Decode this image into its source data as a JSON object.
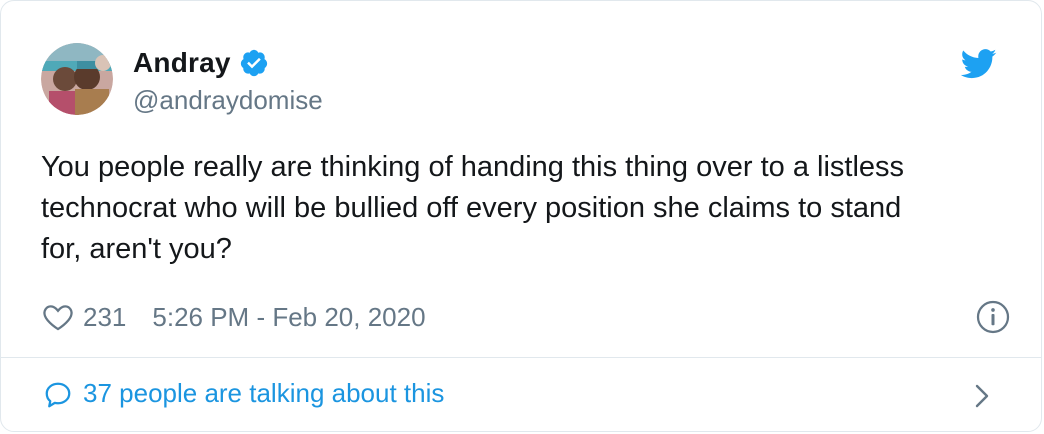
{
  "tweet": {
    "author_name": "Andray",
    "handle": "@andraydomise",
    "text": "You people really are thinking of handing this thing over to a listless\ntechnocrat who will be bullied off every position she claims to stand\nfor, aren't you?",
    "likes": "231",
    "timestamp": "5:26 PM - Feb 20, 2020",
    "talking": "37 people are talking about this"
  },
  "icons": {
    "verified": "verified-badge-icon",
    "bird": "twitter-bird-icon",
    "heart": "heart-icon",
    "info": "info-icon",
    "bubble": "speech-bubble-icon",
    "chevron": "chevron-right-icon"
  },
  "colors": {
    "brand_blue": "#1da1f2",
    "link_blue": "#1b95e0",
    "text_primary": "#14171a",
    "text_secondary": "#657786",
    "border": "#e1e8ed"
  }
}
